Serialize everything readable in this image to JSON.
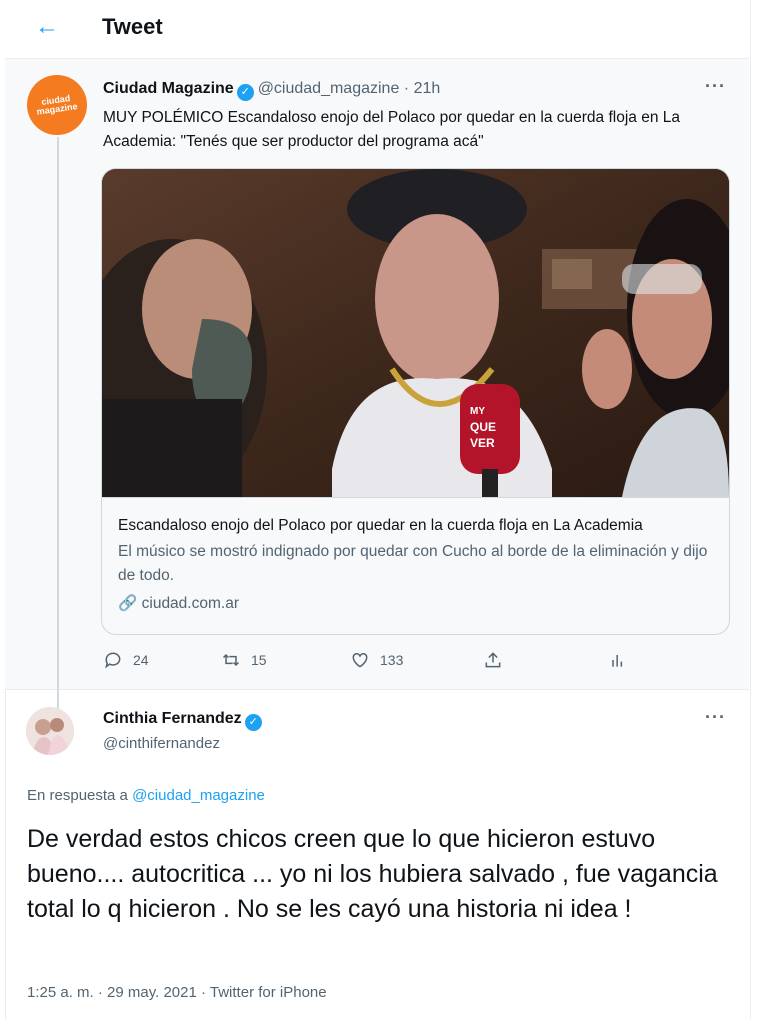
{
  "header": {
    "title": "Tweet",
    "back_icon": "arrow-left-icon"
  },
  "tweet": {
    "author_name": "Ciudad Magazine",
    "author_handle": "@ciudad_magazine",
    "time": "21h",
    "avatar_text": "ciudad magazine",
    "more_label": "···",
    "text": "MUY POLÉMICO Escandaloso enojo del Polaco por quedar en la cuerda floja en La Academia: \"Tenés que ser productor del programa acá\"",
    "card": {
      "title": "Escandaloso enojo del Polaco por quedar en la cuerda floja en La Academia",
      "description": "El músico se mostró indignado por quedar con Cucho al borde de la eliminación y dijo de todo.",
      "domain": "ciudad.com.ar",
      "mic_text_1": "MY",
      "mic_text_2": "QUE",
      "mic_text_3": "VER"
    },
    "actions": {
      "replies": "24",
      "retweets": "15",
      "likes": "133"
    }
  },
  "reply": {
    "author_name": "Cinthia Fernandez",
    "author_handle": "@cinthifernandez",
    "more_label": "···",
    "reply_prefix": "En respuesta a",
    "reply_to": "@ciudad_magazine",
    "text": "De verdad estos chicos creen que lo que hicieron estuvo bueno.... autocritica ... yo ni los hubiera salvado , fue vagancia total lo q hicieron . No se les cayó una historia ni idea !",
    "time": "1:25 a. m.",
    "date": "29 may. 2021",
    "source": "Twitter for iPhone"
  },
  "colors": {
    "accent": "#1da1f2",
    "secondary_text": "#536471",
    "border": "#e6ecf0"
  }
}
